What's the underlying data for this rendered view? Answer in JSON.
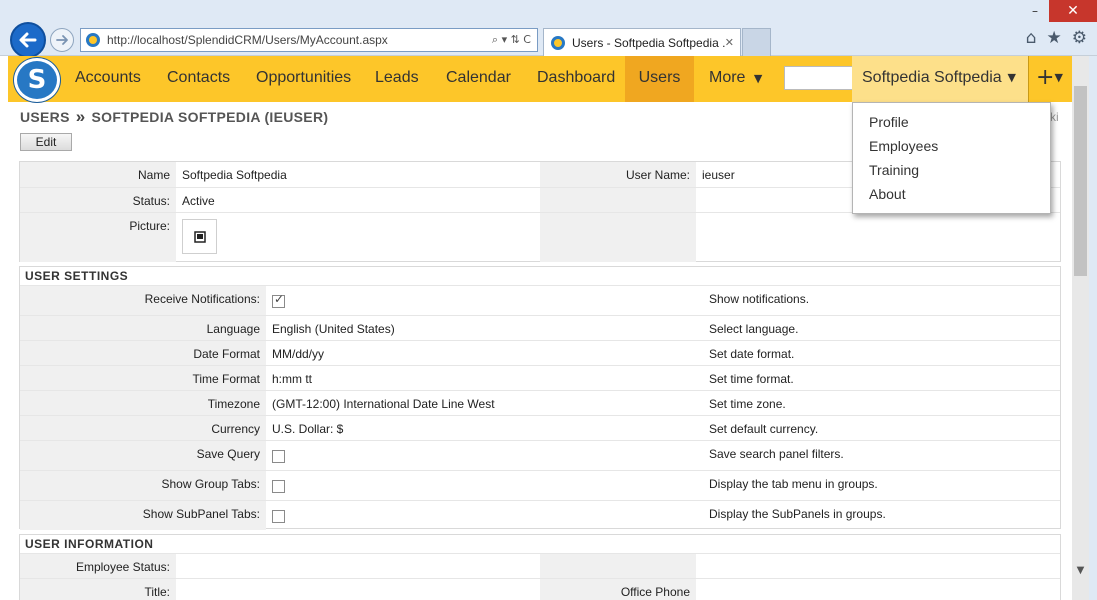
{
  "browser": {
    "url": "http://localhost/SplendidCRM/Users/MyAccount.aspx",
    "tab_title": "Users - Softpedia Softpedia ...",
    "minimize": "–",
    "close": "✕",
    "tab_close": "✕",
    "addr_controls": "⌕ ▾ ⇅ C",
    "home_icon": "⌂",
    "favorites_icon": "★",
    "tools_icon": "⚙"
  },
  "nav": {
    "items": [
      "Accounts",
      "Contacts",
      "Opportunities",
      "Leads",
      "Calendar",
      "Dashboard",
      "Users",
      "More"
    ],
    "active": "Users",
    "more_caret": "▼",
    "user_name": "Softpedia Softpedia",
    "user_caret": "▼",
    "plus": "+",
    "plus_caret": "▼"
  },
  "user_menu": {
    "items": [
      "Profile",
      "Employees",
      "Training",
      "About"
    ]
  },
  "breadcrumb": {
    "part1": "USERS",
    "sep": "»",
    "part2": "SOFTPEDIA SOFTPEDIA (IEUSER)",
    "right_fragment": "ki"
  },
  "edit_label": "Edit",
  "details": {
    "name_label": "Name",
    "name_value": "Softpedia Softpedia",
    "username_label": "User Name:",
    "username_value": "ieuser",
    "status_label": "Status:",
    "status_value": "Active",
    "picture_label": "Picture:"
  },
  "user_settings": {
    "title": "USER SETTINGS",
    "rows": [
      {
        "label": "Receive Notifications:",
        "value": "",
        "checkbox": true,
        "checked": true,
        "help": "Show notifications."
      },
      {
        "label": "Language",
        "value": "English (United States)",
        "checkbox": false,
        "help": "Select language."
      },
      {
        "label": "Date Format",
        "value": "MM/dd/yy",
        "checkbox": false,
        "help": "Set date format."
      },
      {
        "label": "Time Format",
        "value": "h:mm tt",
        "checkbox": false,
        "help": "Set time format."
      },
      {
        "label": "Timezone",
        "value": "(GMT-12:00) International Date Line West",
        "checkbox": false,
        "help": "Set time zone."
      },
      {
        "label": "Currency",
        "value": "U.S. Dollar: $",
        "checkbox": false,
        "help": "Set default currency."
      },
      {
        "label": "Save Query",
        "value": "",
        "checkbox": true,
        "checked": false,
        "help": "Save search panel filters."
      },
      {
        "label": "Show Group Tabs:",
        "value": "",
        "checkbox": true,
        "checked": false,
        "help": "Display the tab menu in groups."
      },
      {
        "label": "Show SubPanel Tabs:",
        "value": "",
        "checkbox": true,
        "checked": false,
        "help": "Display the SubPanels in groups."
      }
    ]
  },
  "user_information": {
    "title": "USER INFORMATION",
    "employee_status_label": "Employee Status:",
    "title_label": "Title:",
    "office_phone_label": "Office Phone"
  },
  "scroll": {
    "down": "▼"
  },
  "colors": {
    "nav_bg": "#fdc629",
    "nav_active": "#f0a720",
    "user_btn": "#fde08a",
    "logo_blue": "#2778c4"
  }
}
